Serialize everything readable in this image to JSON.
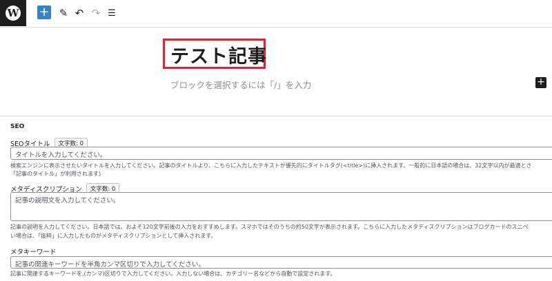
{
  "toolbar": {
    "logo_letter": "W",
    "add_symbol": "+",
    "tools_symbol": "✎",
    "undo_symbol": "↶",
    "redo_symbol": "↷",
    "outline_symbol": "☰"
  },
  "editor": {
    "post_title": "テスト記事",
    "block_placeholder": "ブロックを選択するには「/」を入力",
    "inline_add_symbol": "+"
  },
  "seo": {
    "section_title": "SEO",
    "seo_title": {
      "label": "SEOタイトル",
      "count": "文字数: 0",
      "placeholder": "タイトルを入力してください。",
      "help_line1": "検索エンジンに表示させたいタイトルを入力してください。記事のタイトルより、こちらに入力したテキストが優先的にタイトルタグ(<title>)に挿入されます。一般的に日本語の場合は、32文字以内が最適とさ",
      "help_line2": "「記事のタイトル」が利用されます)"
    },
    "meta_description": {
      "label": "メタディスクリプション",
      "count": "文字数: 0",
      "placeholder": "記事の説明文を入力してください。",
      "help_line1": "記事の説明を入力してください。日本語では、およそ120文字前後の入力をおすすめします。スマホではそのうちの約50文字が表示されます。こちらに入力したメタディスクリプションはブログカードのスニペ",
      "help_line2": "い場合は、「抜粋」に入力したものがメタディスクリプションとして挿入されます。"
    },
    "meta_keywords": {
      "label": "メタキーワード",
      "placeholder": "記事の関連キーワードを半角カンマ区切りで入力してください。",
      "help_line1": "記事に関連するキーワードを,(カンマ)区切りで入力してください。入力しない場合は、カテゴリー名などから自動で設定されます。"
    }
  }
}
